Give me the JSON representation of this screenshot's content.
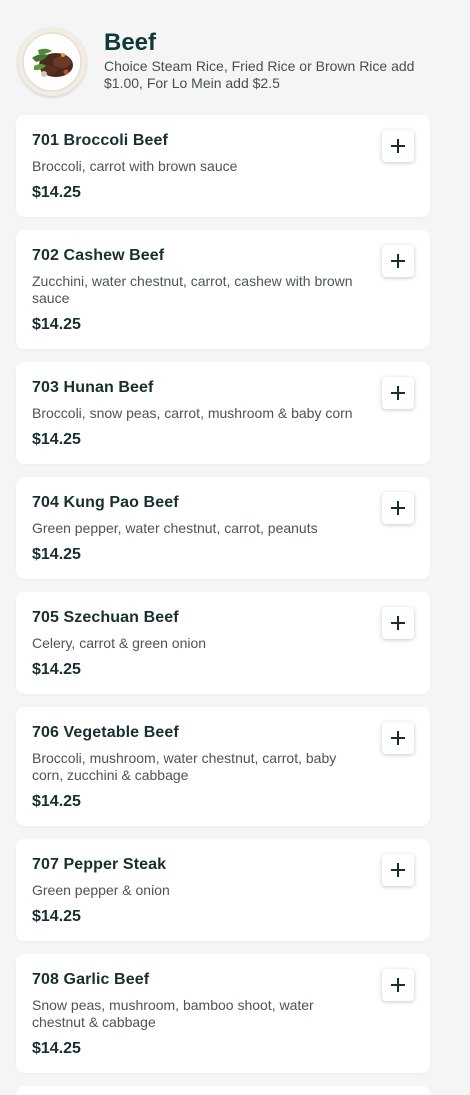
{
  "category": {
    "title": "Beef",
    "description": "Choice Steam Rice, Fried Rice or Brown Rice add $1.00, For Lo Mein add $2.5",
    "image_icon": "beef-dish-photo"
  },
  "add_icon": "plus-icon",
  "items": [
    {
      "name": "701 Broccoli Beef",
      "description": "Broccoli, carrot with brown sauce",
      "price": "$14.25"
    },
    {
      "name": "702 Cashew Beef",
      "description": "Zucchini, water chestnut, carrot, cashew with brown sauce",
      "price": "$14.25"
    },
    {
      "name": "703 Hunan Beef",
      "description": "Broccoli, snow peas, carrot, mushroom & baby corn",
      "price": "$14.25"
    },
    {
      "name": "704 Kung Pao Beef",
      "description": "Green pepper, water chestnut, carrot, peanuts",
      "price": "$14.25"
    },
    {
      "name": "705 Szechuan Beef",
      "description": "Celery, carrot & green onion",
      "price": "$14.25"
    },
    {
      "name": "706 Vegetable Beef",
      "description": "Broccoli, mushroom, water chestnut, carrot, baby corn, zucchini & cabbage",
      "price": "$14.25"
    },
    {
      "name": "707 Pepper Steak",
      "description": "Green pepper & onion",
      "price": "$14.25"
    },
    {
      "name": "708 Garlic Beef",
      "description": "Snow peas, mushroom, bamboo shoot, water chestnut & cabbage",
      "price": "$14.25"
    }
  ]
}
